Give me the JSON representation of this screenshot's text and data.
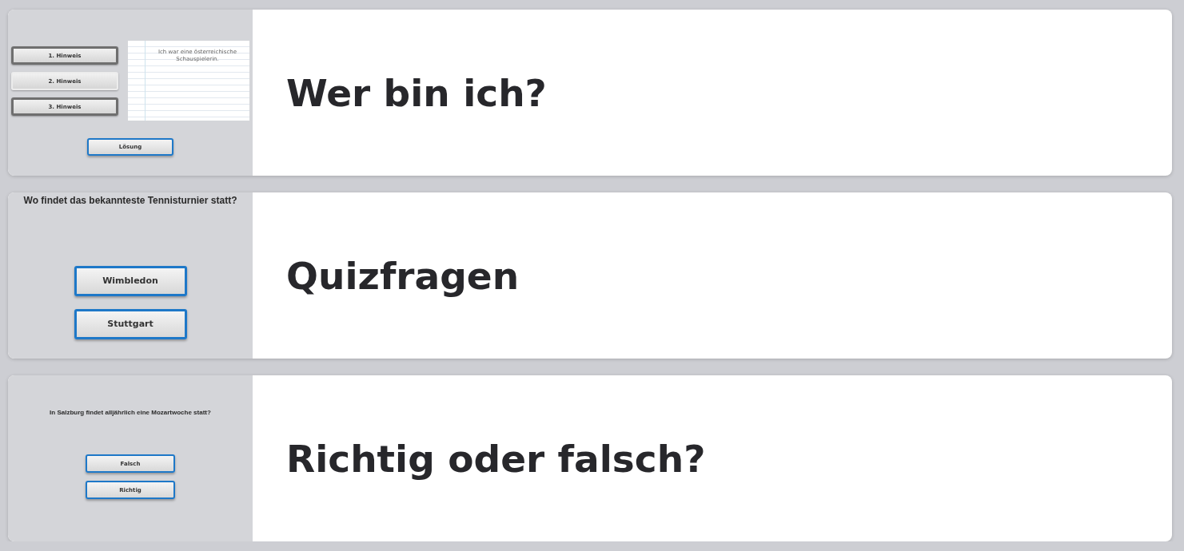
{
  "cards": [
    {
      "kind": "hints",
      "title": "Wer bin ich?",
      "hints": [
        {
          "label": "1. Hinweis",
          "selected": false
        },
        {
          "label": "2. Hinweis",
          "selected": true
        },
        {
          "label": "3. Hinweis",
          "selected": false
        }
      ],
      "note_lines": [
        "Ich war eine österreichische",
        "Schauspielerin."
      ],
      "solution": "Lösung"
    },
    {
      "kind": "quiz",
      "title": "Quizfragen",
      "question": "Wo findet das bekannteste Tennisturnier statt?",
      "answers": [
        "Wimbledon",
        "Stuttgart"
      ]
    },
    {
      "kind": "truefalse",
      "title": "Richtig oder falsch?",
      "question": "In Salzburg findet alljährlich eine Mozartwoche statt?",
      "answers": [
        "Falsch",
        "Richtig"
      ]
    }
  ]
}
